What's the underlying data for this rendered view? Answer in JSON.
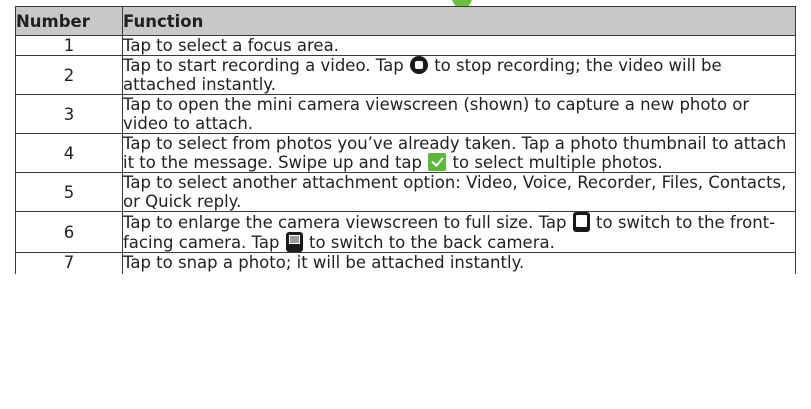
{
  "table": {
    "headers": {
      "number": "Number",
      "function": "Function"
    },
    "rows": [
      {
        "number": "1",
        "text": "Tap to select a focus area."
      },
      {
        "number": "2",
        "text_a": "Tap to start recording a video. Tap",
        "icon": "stop-record-icon",
        "text_b": "to stop recording; the video will be attached instantly."
      },
      {
        "number": "3",
        "text": "Tap to open the mini camera viewscreen (shown) to capture a new photo or video to attach."
      },
      {
        "number": "4",
        "text_a": "Tap to select from photos you’ve already taken. Tap a photo thumbnail to attach it to the message. Swipe up and tap",
        "icon": "checkbox-icon",
        "text_b": "to select multiple photos."
      },
      {
        "number": "5",
        "text": "Tap to select another attachment option: Video, Voice, Recorder, Files, Contacts, or Quick reply."
      },
      {
        "number": "6",
        "text_a": "Tap to enlarge the camera viewscreen to full size. Tap",
        "icon_a": "front-camera-icon",
        "text_b": "to switch to the front-facing camera. Tap",
        "icon_b": "back-camera-icon",
        "text_c": "to switch to the back camera."
      },
      {
        "number": "7",
        "text": "Tap to snap a photo; it will be attached instantly."
      }
    ]
  },
  "colors": {
    "header_bg": "#c7c8ca",
    "accent_green": "#6cbf3f"
  }
}
